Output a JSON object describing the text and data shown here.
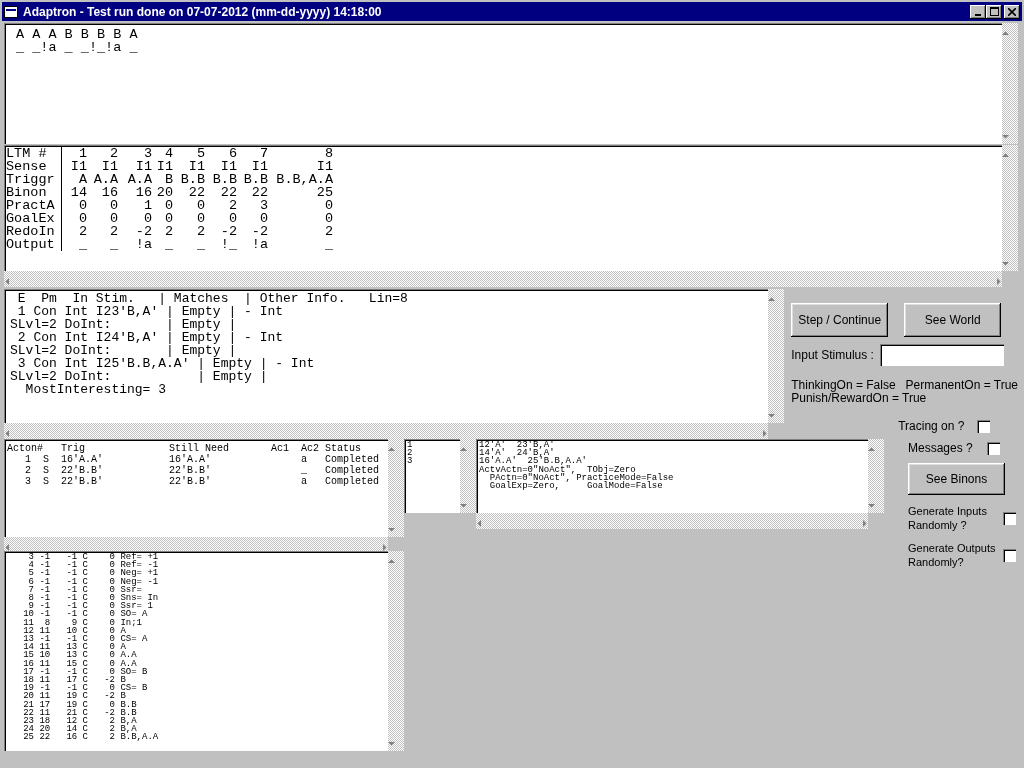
{
  "window": {
    "title": "Adaptron - Test run done on 07-07-2012 (mm-dd-yyyy) 14:18:00"
  },
  "history": {
    "lines": [
      "A A A B B B B A",
      "_ _!a _ _!_!a _"
    ]
  },
  "ltm": {
    "rows": [
      {
        "label": "LTM #",
        "values": [
          "1",
          "2",
          "3",
          "4",
          "5",
          "6",
          "7",
          "8"
        ]
      },
      {
        "label": "Sense",
        "values": [
          "I1",
          "I1",
          "I1",
          "I1",
          "I1",
          "I1",
          "I1",
          "I1"
        ]
      },
      {
        "label": "Triggr",
        "values": [
          "A",
          "A.A",
          "A.A",
          "B",
          "B.B",
          "B.B",
          "B.B",
          "B.B,A.A"
        ]
      },
      {
        "label": "Binon",
        "values": [
          "14",
          "16",
          "16",
          "20",
          "22",
          "22",
          "22",
          "25"
        ]
      },
      {
        "label": "PractA",
        "values": [
          "0",
          "0",
          "1",
          "0",
          "0",
          "2",
          "3",
          "0"
        ]
      },
      {
        "label": "GoalEx",
        "values": [
          "0",
          "0",
          "0",
          "0",
          "0",
          "0",
          "0",
          "0"
        ]
      },
      {
        "label": "RedoIn",
        "values": [
          "2",
          "2",
          "-2",
          "2",
          "2",
          "-2",
          "-2",
          "2"
        ]
      },
      {
        "label": "Output",
        "values": [
          "_",
          "_",
          "!a",
          "_",
          "_",
          "!_",
          "!a",
          "_"
        ]
      }
    ]
  },
  "trace": {
    "lines": [
      " E  Pm  In Stim.   | Matches  | Other Info.   Lin=8",
      " 1 Con Int I23'B,A' | Empty | - Int",
      "SLvl=2 DoInt:       | Empty |",
      " 2 Con Int I24'B,A' | Empty | - Int",
      "SLvl=2 DoInt:       | Empty |",
      " 3 Con Int I25'B.B,A.A' | Empty | - Int",
      "SLvl=2 DoInt:           | Empty |",
      "  MostInteresting= 3"
    ]
  },
  "buttons": [
    {
      "label": "Step / Continue"
    },
    {
      "label": "See World"
    }
  ],
  "input_stimulus": {
    "label": "Input Stimulus :"
  },
  "status": {
    "lines": [
      "ThinkingOn = False   PermanentOn = True",
      "Punish/RewardOn = True"
    ]
  },
  "options": [
    {
      "label": "Tracing on ?",
      "checked": false
    },
    {
      "label": "Messages ?",
      "checked": false
    }
  ],
  "actions": {
    "lines": [
      "Acton#   Trig              Still Need       Ac1  Ac2 Status",
      "   1  S  16'A.A'           16'A.A'               a   Completed",
      "   2  S  22'B.B'           22'B.B'               _   Completed",
      "   3  S  22'B.B'           22'B.B'               a   Completed"
    ]
  },
  "numbers_list": {
    "items": [
      "1",
      "2",
      "3"
    ]
  },
  "details": {
    "lines": [
      "12'A'  23'B,A'",
      "14'A'  24'B,A'",
      "16'A.A'  25'B.B,A.A'",
      "ActvActn=0\"NoAct\",  TObj=Zero",
      "  PActn=0\"NoAct\", PracticeMode=False",
      "  GoalExp=Zero,     GoalMode=False"
    ]
  },
  "see_binons": {
    "label": "See Binons"
  },
  "generate": [
    {
      "label": "Generate Inputs Randomly ?",
      "checked": false
    },
    {
      "label": "Generate Outputs Randomly?",
      "checked": false
    }
  ],
  "binons": {
    "lines": [
      "    3 -1   -1 C    0 Ref= +1",
      "    4 -1   -1 C    0 Ref= -1",
      "    5 -1   -1 C    0 Neg= +1",
      "    6 -1   -1 C    0 Neg= -1",
      "    7 -1   -1 C    0 Ssr=",
      "    8 -1   -1 C    0 Sns= In",
      "    9 -1   -1 C    0 Ssr= 1",
      "   10 -1   -1 C    0 SO= A",
      "   11  8    9 C    0 In;1",
      "   12 11   10 C    0 A",
      "   13 -1   -1 C    0 CS= A",
      "   14 11   13 C    0 A",
      "   15 10   13 C    0 A.A",
      "   16 11   15 C    0 A.A",
      "   17 -1   -1 C    0 SO= B",
      "   18 11   17 C   -2 B",
      "   19 -1   -1 C    0 CS= B",
      "   20 11   19 C   -2 B",
      "   21 17   19 C    0 B.B",
      "   22 11   21 C   -2 B.B",
      "   23 18   12 C    2 B,A",
      "   24 20   14 C    2 B,A",
      "   25 22   16 C    2 B.B,A.A"
    ]
  }
}
